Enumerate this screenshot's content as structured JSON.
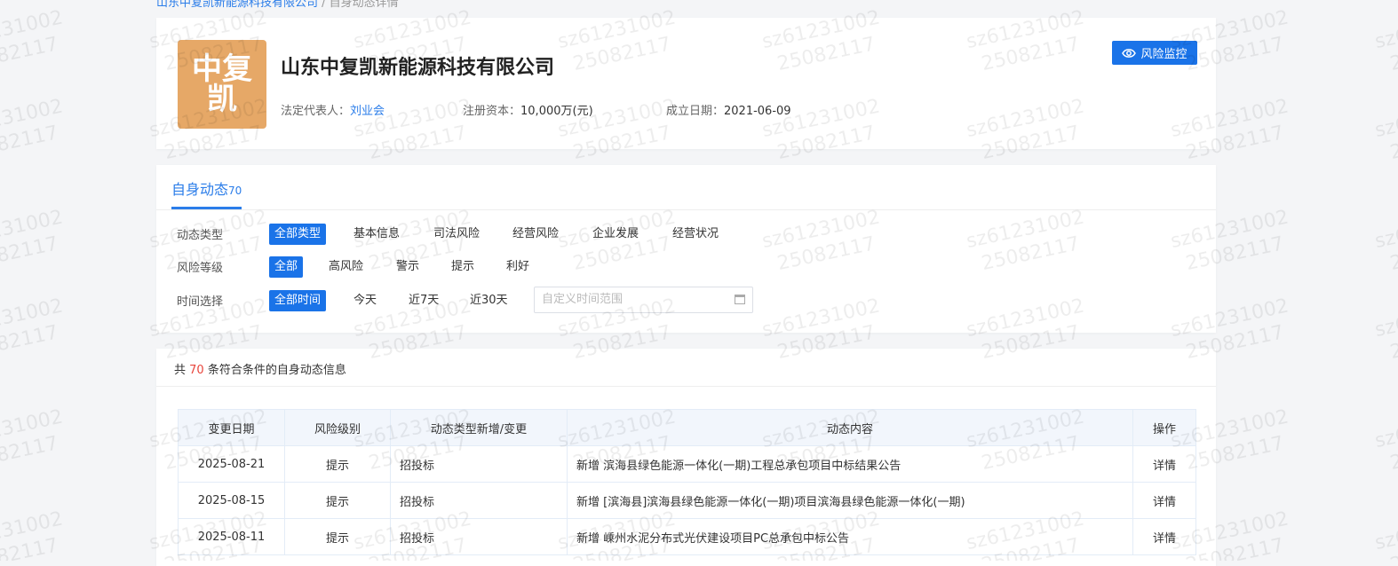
{
  "breadcrumb": {
    "link": "山东中复凯新能源科技有限公司",
    "current": "自身动态详情"
  },
  "company": {
    "logo_line1": "中复",
    "logo_line2": "凯",
    "name": "山东中复凯新能源科技有限公司",
    "legal_rep_label": "法定代表人：",
    "legal_rep": "刘业会",
    "capital_label": "注册资本：",
    "capital": "10,000万(元)",
    "founded_label": "成立日期：",
    "founded": "2021-06-09",
    "monitor_button": "风险监控"
  },
  "tab": {
    "label": "自身动态",
    "count": "70"
  },
  "filters": {
    "type_label": "动态类型",
    "type_options": [
      "全部类型",
      "基本信息",
      "司法风险",
      "经营风险",
      "企业发展",
      "经营状况"
    ],
    "level_label": "风险等级",
    "level_options": [
      "全部",
      "高风险",
      "警示",
      "提示",
      "利好"
    ],
    "time_label": "时间选择",
    "time_options": [
      "全部时间",
      "今天",
      "近7天",
      "近30天"
    ],
    "date_placeholder": "自定义时间范围"
  },
  "summary": {
    "prefix": "共",
    "count": "70",
    "suffix": "条符合条件的自身动态信息"
  },
  "table": {
    "headers": [
      "变更日期",
      "风险级别",
      "动态类型新增/变更",
      "动态内容",
      "操作"
    ],
    "rows": [
      {
        "date": "2025-08-21",
        "level": "提示",
        "type": "招投标",
        "content": "新增 滨海县绿色能源一体化(一期)工程总承包项目中标结果公告",
        "action": "详情"
      },
      {
        "date": "2025-08-15",
        "level": "提示",
        "type": "招投标",
        "content": "新增 [滨海县]滨海县绿色能源一体化(一期)项目滨海县绿色能源一体化(一期)",
        "action": "详情"
      },
      {
        "date": "2025-08-11",
        "level": "提示",
        "type": "招投标",
        "content": "新增 嵊州水泥分布式光伏建设项目PC总承包中标公告",
        "action": "详情"
      }
    ]
  },
  "watermark": {
    "line1": "sz61231002",
    "line2": "25082117"
  }
}
